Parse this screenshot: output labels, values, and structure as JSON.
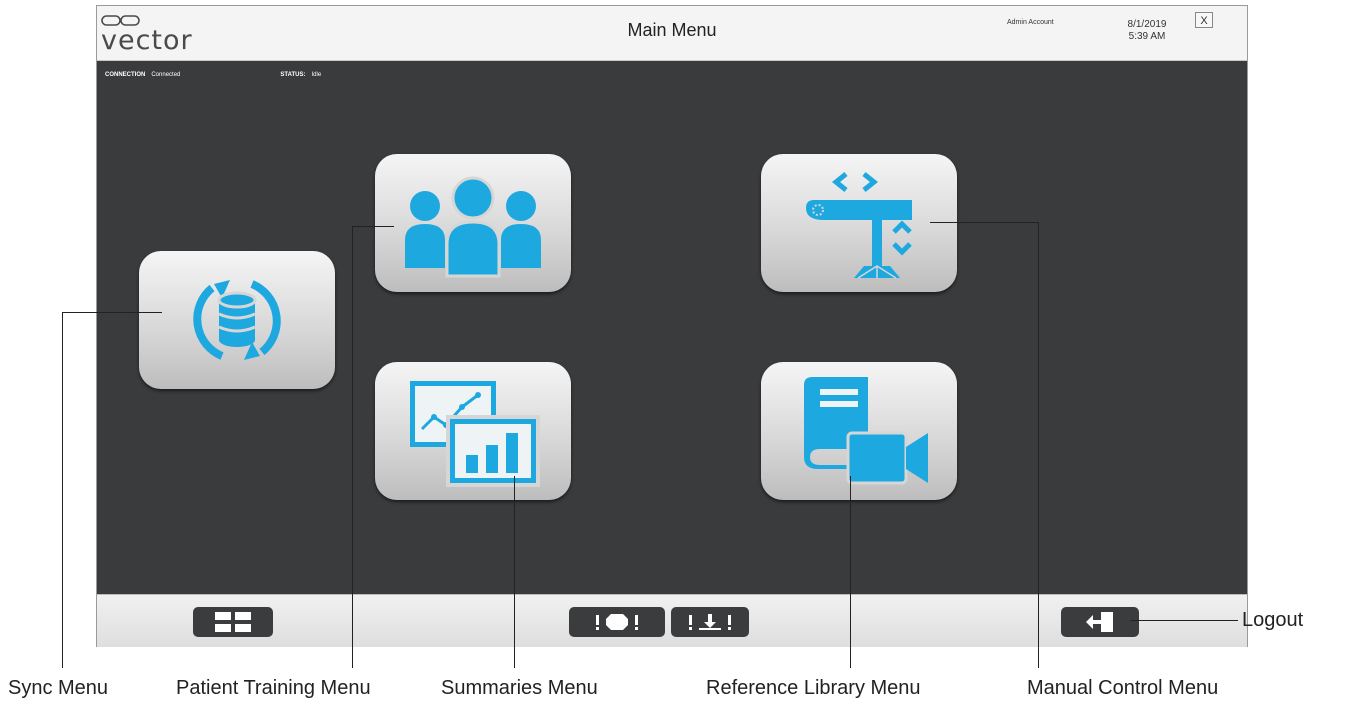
{
  "app": {
    "logo_text": "vector",
    "title": "Main Menu",
    "account": "Admin Account",
    "date": "8/1/2019",
    "time": "5:39 AM",
    "close_label": "X"
  },
  "status": {
    "connection_label": "CONNECTION",
    "connection_value": "Connected",
    "status_label": "STATUS:",
    "status_value": "Idle"
  },
  "tiles": [
    {
      "name": "sync-menu",
      "icon": "database-sync-icon"
    },
    {
      "name": "patient-training-menu",
      "icon": "users-group-icon"
    },
    {
      "name": "manual-control-menu",
      "icon": "trolley-control-icon"
    },
    {
      "name": "summaries-menu",
      "icon": "charts-icon"
    },
    {
      "name": "reference-library-menu",
      "icon": "book-video-icon"
    }
  ],
  "bottom_buttons": [
    {
      "name": "main-menu-button",
      "icon": "grid-icon"
    },
    {
      "name": "alert-button",
      "icon": "alert-stop-icon"
    },
    {
      "name": "lower-button",
      "icon": "lower-icon"
    },
    {
      "name": "logout-button",
      "icon": "logout-icon"
    }
  ],
  "callouts": {
    "sync": "Sync Menu",
    "patient": "Patient Training Menu",
    "summaries": "Summaries Menu",
    "reference": "Reference Library Menu",
    "manual": "Manual Control Menu",
    "logout": "Logout"
  },
  "colors": {
    "accent": "#1ea8e0",
    "background": "#3a3b3d",
    "tile": "#d6d6d6"
  }
}
